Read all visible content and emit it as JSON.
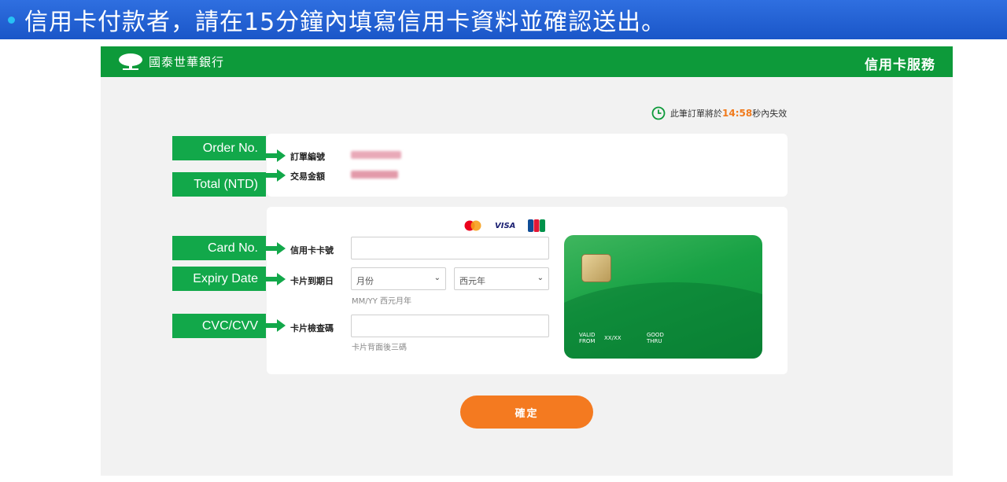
{
  "banner": {
    "text": "信用卡付款者，請在15分鐘內填寫信用卡資料並確認送出。"
  },
  "header": {
    "bank_name": "國泰世華銀行",
    "service_title": "信用卡服務"
  },
  "timer": {
    "prefix": "此筆訂單將於",
    "time": "14:58",
    "suffix": "秒內失效"
  },
  "order": {
    "order_no_label": "訂單編號",
    "amount_label": "交易金額"
  },
  "card_brands": [
    "mastercard",
    "VISA",
    "JCB"
  ],
  "form": {
    "card_no_label": "信用卡卡號",
    "card_no_value": "",
    "expiry_label": "卡片到期日",
    "month_select": "月份",
    "year_select": "西元年",
    "expiry_hint": "MM/YY 西元月年",
    "cvc_label": "卡片檢查碼",
    "cvc_value": "",
    "cvc_hint": "卡片背面後三碼"
  },
  "card_visual": {
    "valid_from": "VALID\nFROM",
    "date_placeholder": "XX/XX",
    "good_thru": "GOOD\nTHRU"
  },
  "confirm_label": "確定",
  "annotations": {
    "order_no": "Order No.",
    "total": "Total (NTD)",
    "card_no": "Card No.",
    "expiry": "Expiry Date",
    "cvc": "CVC/CVV"
  },
  "colors": {
    "brand_green": "#0d9a3a",
    "banner_blue": "#1a56c8",
    "accent_orange": "#f47a20",
    "annotation_green": "#12a84a"
  }
}
